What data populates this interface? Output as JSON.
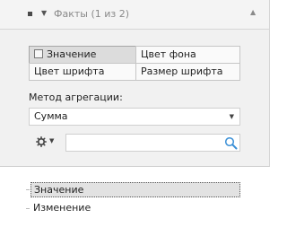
{
  "header": {
    "title": "Факты (1 из 2)",
    "menu_icon": "square-icon",
    "dropdown_icon": "caret-down-icon",
    "collapse_icon": "caret-up-icon"
  },
  "format_buttons": {
    "value_label": "Значение",
    "bg_color_label": "Цвет фона",
    "font_color_label": "Цвет шрифта",
    "font_size_label": "Размер шрифта"
  },
  "aggregation": {
    "label": "Метод агрегации:",
    "selected": "Сумма"
  },
  "filter": {
    "gear_icon": "gear-icon",
    "search_value": "",
    "search_icon": "search-icon"
  },
  "facts_list": {
    "items": [
      "Значение",
      "Изменение"
    ],
    "selected_index": 0
  },
  "colors": {
    "header_bg": "#f4f4f4",
    "settings_bg": "#f1f1f1",
    "pressed_bg": "#dcdcdc",
    "search_icon": "#3a8fd6"
  }
}
